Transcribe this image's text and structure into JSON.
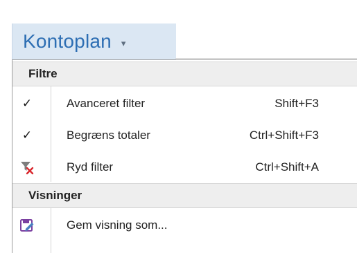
{
  "header": {
    "title": "Kontoplan",
    "caret": "▾"
  },
  "sections": [
    {
      "label": "Filtre",
      "items": [
        {
          "label": "Avanceret filter",
          "shortcut": "Shift+F3",
          "icon": "check-icon",
          "checked": true
        },
        {
          "label": "Begræns totaler",
          "shortcut": "Ctrl+Shift+F3",
          "icon": "check-icon",
          "checked": true
        },
        {
          "label": "Ryd filter",
          "shortcut": "Ctrl+Shift+A",
          "icon": "clear-filter-icon",
          "checked": false
        }
      ]
    },
    {
      "label": "Visninger",
      "items": [
        {
          "label": "Gem visning som...",
          "shortcut": "",
          "icon": "save-view-icon",
          "checked": false
        }
      ]
    }
  ],
  "colors": {
    "title_text": "#2d6eb3",
    "title_bg": "#dbe7f3",
    "section_bg": "#eeeeee",
    "clear_x": "#d9262c",
    "save_icon": "#7a3fa0"
  }
}
